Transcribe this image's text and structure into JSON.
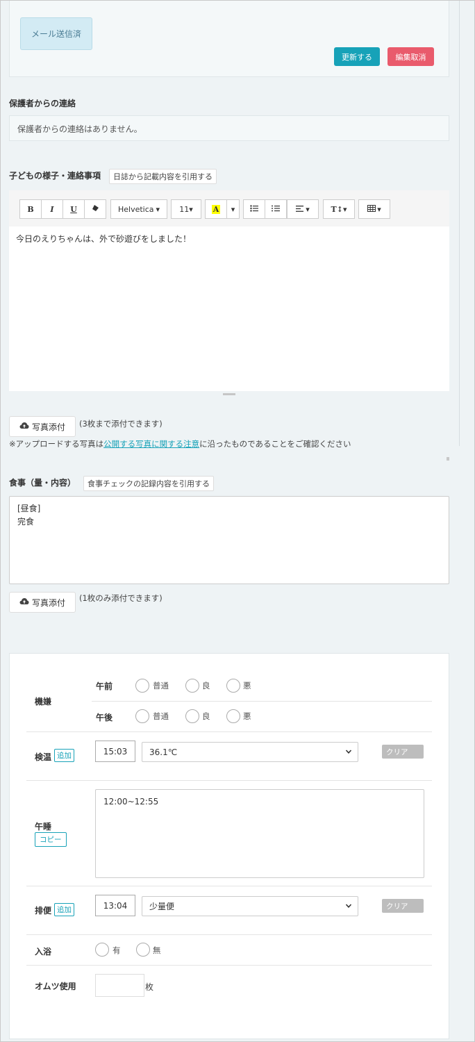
{
  "top": {
    "mail_status": "メール送信済",
    "update_button": "更新する",
    "cancel_button": "編集取消"
  },
  "guardian": {
    "heading": "保護者からの連絡",
    "message": "保護者からの連絡はありません。"
  },
  "child_notes": {
    "heading": "子どもの様子・連絡事項",
    "cite_button": "日誌から記載内容を引用する",
    "toolbar": {
      "bold": "B",
      "italic": "I",
      "underline": "U",
      "font_family": "Helvetica",
      "font_size": "11",
      "color_letter": "A"
    },
    "content": "今日のえりちゃんは、外で砂遊びをしました！",
    "photo_button": "写真添付",
    "photo_limit": "(3枚まで添付できます)",
    "notice_prefix": "※アップロードする写真は",
    "notice_link": "公開する写真に関する注意",
    "notice_suffix": "に沿ったものであることをご確認ください"
  },
  "meal": {
    "heading": "食事（量・内容）",
    "cite_button": "食事チェックの記録内容を引用する",
    "content": "[昼食]\n完食",
    "photo_button": "写真添付",
    "photo_limit": "(1枚のみ添付できます)"
  },
  "health": {
    "mood": {
      "label": "機嫌",
      "am_label": "午前",
      "pm_label": "午後",
      "am_options": [
        "普通",
        "良",
        "悪"
      ],
      "pm_options": [
        "普通",
        "良",
        "悪"
      ]
    },
    "temperature": {
      "label": "検温",
      "add_tag": "追加",
      "time": "15:03",
      "value": "36.1℃",
      "clear": "クリア"
    },
    "nap": {
      "label": "午睡",
      "copy_tag": "コピー",
      "content": "12:00~12:55"
    },
    "excretion": {
      "label": "排便",
      "add_tag": "追加",
      "time": "13:04",
      "value": "少量便",
      "clear": "クリア"
    },
    "bath": {
      "label": "入浴",
      "options": [
        "有",
        "無"
      ]
    },
    "diaper": {
      "label": "オムツ使用",
      "unit": "枚"
    }
  },
  "colors": {
    "accent": "#17a2b8",
    "danger": "#e95b6c",
    "page_bg": "#eef3f5"
  }
}
